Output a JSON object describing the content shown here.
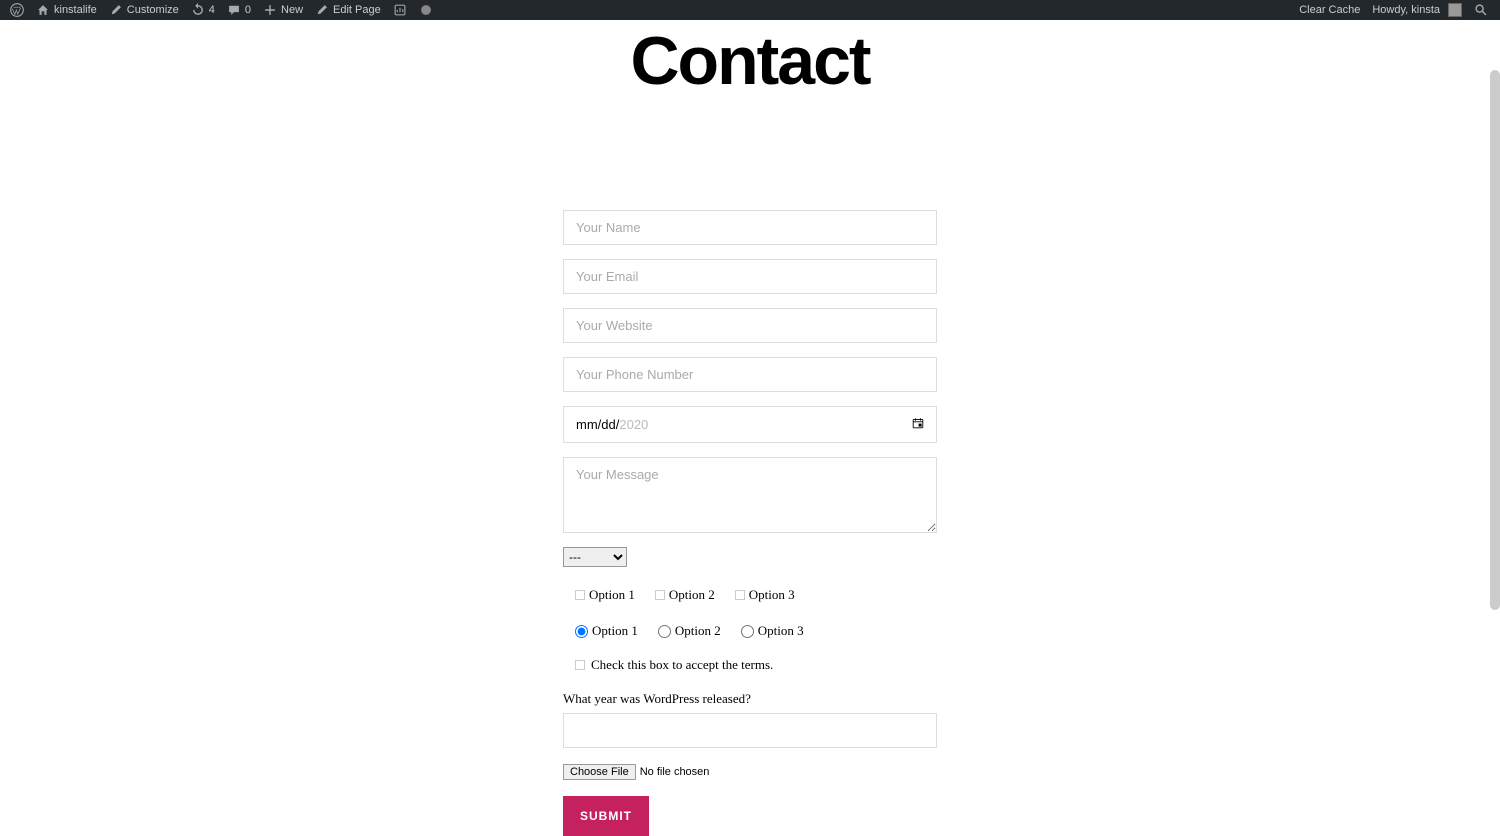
{
  "adminbar": {
    "site_name": "kinstalife",
    "customize": "Customize",
    "updates_count": "4",
    "comments_count": "0",
    "new": "New",
    "edit_page": "Edit Page",
    "clear_cache": "Clear Cache",
    "howdy": "Howdy, kinsta"
  },
  "page": {
    "title": "Contact"
  },
  "form": {
    "name_placeholder": "Your Name",
    "email_placeholder": "Your Email",
    "website_placeholder": "Your Website",
    "phone_placeholder": "Your Phone Number",
    "date_mm": "mm",
    "date_dd": "dd",
    "date_yyyy": "2020",
    "message_placeholder": "Your Message",
    "select_default": "---",
    "checkbox_options": {
      "opt1": "Option 1",
      "opt2": "Option 2",
      "opt3": "Option 3"
    },
    "radio_options": {
      "opt1": "Option 1",
      "opt2": "Option 2",
      "opt3": "Option 3"
    },
    "terms_text": "Check this box to accept the terms.",
    "quiz_question": "What year was WordPress released?",
    "file_button": "Choose File",
    "file_status": "No file chosen",
    "submit": "SUBMIT"
  }
}
